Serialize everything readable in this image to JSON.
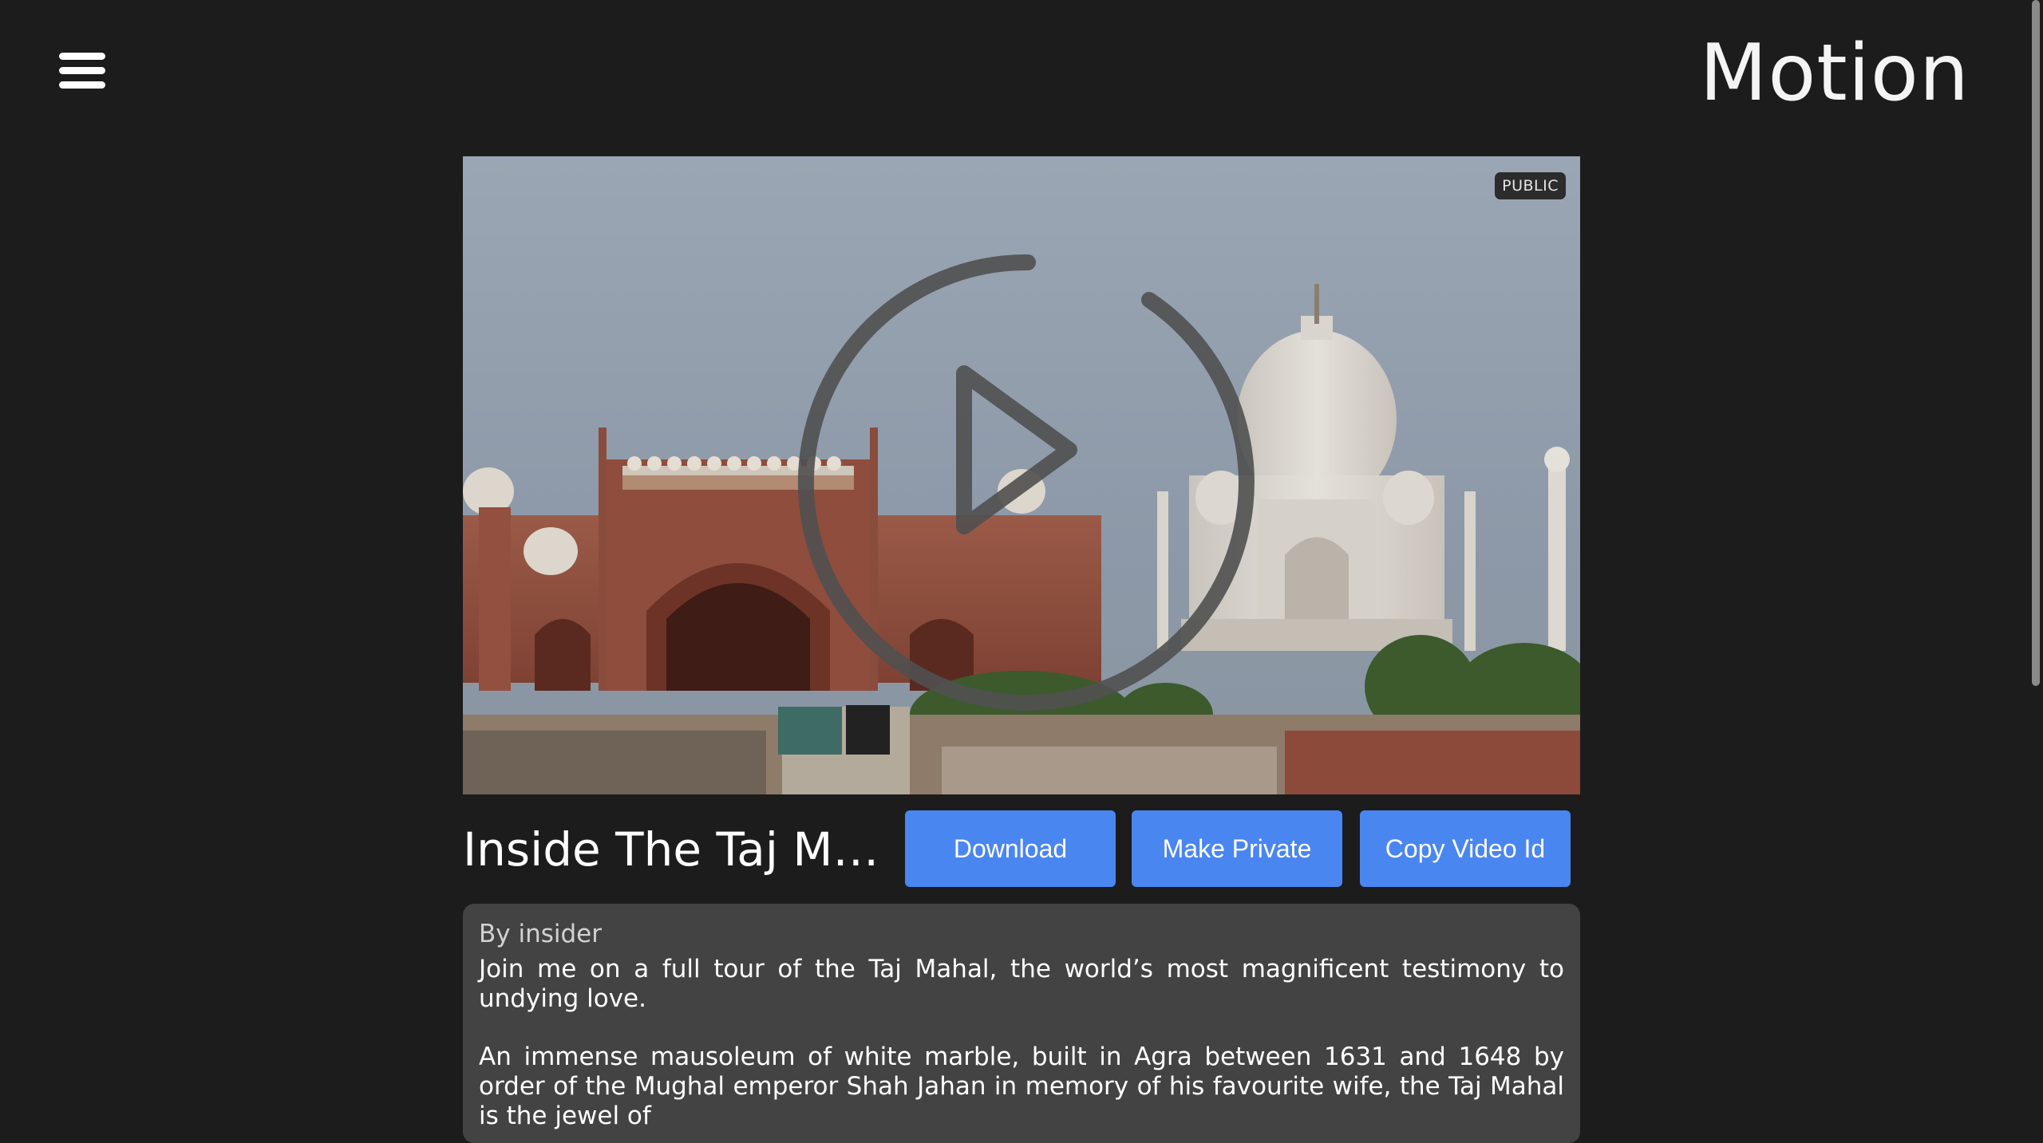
{
  "header": {
    "menu_icon": "hamburger-menu-icon",
    "brand": "Motion"
  },
  "player": {
    "visibility_badge": "PUBLIC",
    "play_icon": "play-circle-icon"
  },
  "video": {
    "title": "Inside The Taj Mahal",
    "author_line": "By insider",
    "description": [
      "Join me on a full tour of the Taj Mahal, the world’s most magnificent testimony to undying love.",
      "An immense mausoleum of white marble, built in Agra between 1631 and 1648 by order of the Mughal emperor Shah Jahan in memory of his favourite wife, the Taj Mahal is the jewel of"
    ]
  },
  "actions": {
    "download_label": "Download",
    "make_private_label": "Make Private",
    "copy_id_label": "Copy Video Id"
  },
  "colors": {
    "background": "#1c1c1c",
    "accent": "#4a86f0",
    "panel": "#434343"
  }
}
